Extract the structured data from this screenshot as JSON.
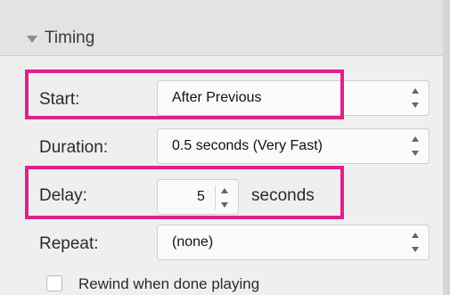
{
  "section": {
    "title": "Timing"
  },
  "rows": {
    "start": {
      "label": "Start:",
      "value": "After Previous"
    },
    "duration": {
      "label": "Duration:",
      "value": "0.5 seconds (Very Fast)"
    },
    "delay": {
      "label": "Delay:",
      "value": "5",
      "units": "seconds"
    },
    "repeat": {
      "label": "Repeat:",
      "value": "(none)"
    }
  },
  "rewind": {
    "label": "Rewind when done playing",
    "checked": false
  },
  "highlight_color": "#e0218a"
}
